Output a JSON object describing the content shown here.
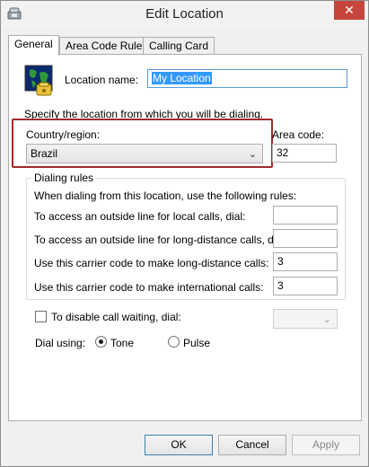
{
  "window": {
    "title": "Edit Location",
    "close_glyph": "✕"
  },
  "tabs": [
    {
      "label": "General",
      "active": true
    },
    {
      "label": "Area Code Rules",
      "active": false
    },
    {
      "label": "Calling Card",
      "active": false
    }
  ],
  "general": {
    "location_name_label": "Location name:",
    "location_name_value": "My Location",
    "specify_text": "Specify the location from which you will be dialing.",
    "country_label": "Country/region:",
    "country_value": "Brazil",
    "area_code_label": "Area code:",
    "area_code_value": "32"
  },
  "dialing_rules": {
    "title": "Dialing rules",
    "intro": "When dialing from this location, use the following rules:",
    "rows": [
      {
        "label": "To access an outside line for local calls, dial:",
        "value": ""
      },
      {
        "label": "To access an outside line for long-distance calls, dial:",
        "value": ""
      },
      {
        "label": "Use this carrier code to make long-distance calls:",
        "value": "3"
      },
      {
        "label": "Use this carrier code to make international calls:",
        "value": "3"
      }
    ]
  },
  "call_waiting": {
    "label": "To disable call waiting, dial:",
    "checked": false,
    "value": ""
  },
  "dial_using": {
    "label": "Dial using:",
    "tone_label": "Tone",
    "pulse_label": "Pulse",
    "selected": "Tone"
  },
  "buttons": {
    "ok": "OK",
    "cancel": "Cancel",
    "apply": "Apply"
  },
  "colors": {
    "highlight_border": "#a52a2a",
    "selection": "#3399ff",
    "close_button": "#c7463c"
  },
  "icons": {
    "title_icon": "phone-icon",
    "location_icon": "globe-phone-icon",
    "dropdown_icon": "chevron-down-icon"
  }
}
